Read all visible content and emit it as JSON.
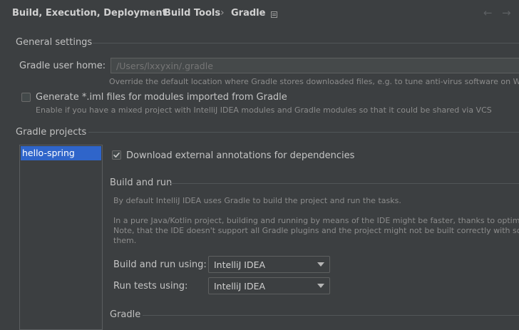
{
  "breadcrumb": {
    "items": [
      "Build, Execution, Deployment",
      "Build Tools",
      "Gradle"
    ],
    "separator": "›",
    "icon": "project-scope-icon"
  },
  "nav": {
    "back": "←",
    "forward": "→"
  },
  "general_settings": {
    "title": "General settings",
    "gradle_user_home": {
      "label": "Gradle user home:",
      "placeholder": "/Users/lxxyxin/.gradle",
      "hint": "Override the default location where Gradle stores downloaded files, e.g. to tune anti-virus software on Windo"
    },
    "generate_iml": {
      "label": "Generate *.iml files for modules imported from Gradle",
      "checked": false,
      "hint": "Enable if you have a mixed project with IntelliJ IDEA modules and Gradle modules so that it could be shared via VCS"
    }
  },
  "gradle_projects": {
    "title": "Gradle projects",
    "projects": [
      "hello-spring"
    ],
    "selected": "hello-spring",
    "download_annotations": {
      "label": "Download external annotations for dependencies",
      "checked": true
    },
    "build_and_run": {
      "title": "Build and run",
      "desc1": "By default IntelliJ IDEA uses Gradle to build the project and run the tasks.",
      "desc2": "In a pure Java/Kotlin project, building and running by means of the IDE might be faster, thanks to optimizatio",
      "desc3": "Note, that the IDE doesn't support all Gradle plugins and the project might not be built correctly with some c",
      "desc4": "them.",
      "build_using": {
        "label": "Build and run using:",
        "value": "IntelliJ IDEA"
      },
      "run_tests_using": {
        "label": "Run tests using:",
        "value": "IntelliJ IDEA"
      }
    },
    "gradle_section_title": "Gradle"
  },
  "colors": {
    "background": "#3c3f41",
    "selection": "#2f65ca",
    "accent_check": "#c7c7c7"
  }
}
